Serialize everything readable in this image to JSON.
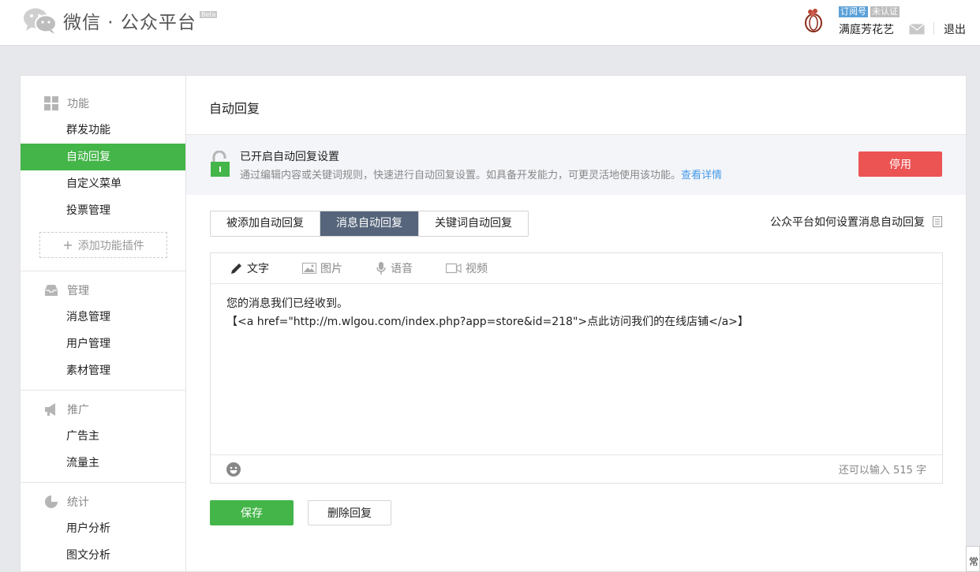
{
  "header": {
    "brand": "微信 · 公众平台",
    "beta": "Beta",
    "account_type_tag": "订阅号",
    "verify_tag": "未认证",
    "account_name": "满庭芳花艺",
    "logout": "退出",
    "mail_icon": "mail-icon"
  },
  "sidebar": {
    "sections": [
      {
        "title": "功能",
        "icon": "grid-icon",
        "items": [
          "群发功能",
          "自动回复",
          "自定义菜单",
          "投票管理"
        ],
        "add_plugin": "添加功能插件"
      },
      {
        "title": "管理",
        "icon": "inbox-icon",
        "items": [
          "消息管理",
          "用户管理",
          "素材管理"
        ]
      },
      {
        "title": "推广",
        "icon": "megaphone-icon",
        "items": [
          "广告主",
          "流量主"
        ]
      },
      {
        "title": "统计",
        "icon": "pie-chart-icon",
        "items": [
          "用户分析",
          "图文分析"
        ]
      }
    ],
    "active_item": "自动回复"
  },
  "main": {
    "title": "自动回复",
    "notice": {
      "title": "已开启自动回复设置",
      "desc": "通过编辑内容或关键词规则，快速进行自动回复设置。如具备开发能力，可更灵活地使用该功能。",
      "link": "查看详情",
      "disable_button": "停用"
    },
    "tabs": [
      "被添加自动回复",
      "消息自动回复",
      "关键词自动回复"
    ],
    "active_tab": "消息自动回复",
    "help_link": "公众平台如何设置消息自动回复",
    "editor": {
      "tabs": [
        "文字",
        "图片",
        "语音",
        "视频"
      ],
      "active_tab": "文字",
      "line1": "您的消息我们已经收到。",
      "line2": "【<a href=\"http://m.wlgou.com/index.php?app=store&id=218\">点此访问我们的在线店铺</a>】",
      "remain": "还可以输入 515 字"
    },
    "save_button": "保存",
    "delete_button": "删除回复"
  },
  "corner_text": "常",
  "colors": {
    "green": "#44b549",
    "red": "#ec5353",
    "tab_active": "#56657b",
    "link": "#459ae9"
  }
}
